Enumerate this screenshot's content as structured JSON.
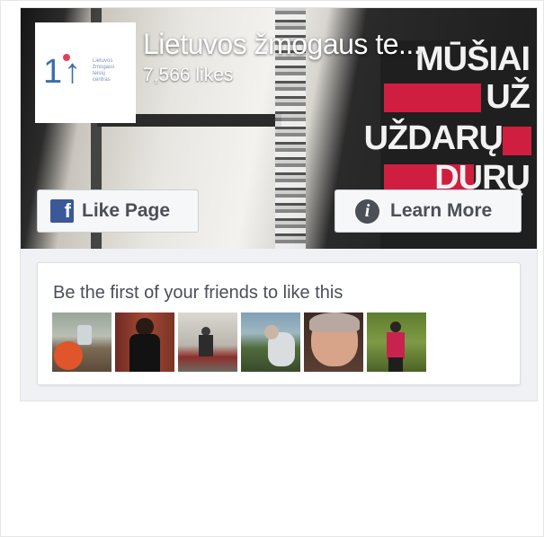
{
  "page": {
    "title": "Lietuvos žmogaus te...",
    "likes": "7,566 likes",
    "logo_text": "Lietuvos\nžmogaus\nteisių\ncentras"
  },
  "cover": {
    "poster_lines": [
      "MŪŠIAI",
      "UŽ",
      "UŽDARŲ",
      "DURŲ"
    ]
  },
  "buttons": {
    "like_page": "Like Page",
    "learn_more": "Learn More"
  },
  "friends": {
    "text": "Be the first of your friends to like this",
    "avatars": [
      "avatar-1",
      "avatar-2",
      "avatar-3",
      "avatar-4",
      "avatar-5",
      "avatar-6"
    ]
  },
  "colors": {
    "facebook_blue": "#3b5998",
    "poster_red": "#d01e40",
    "logo_blue": "#3b6ea8"
  }
}
